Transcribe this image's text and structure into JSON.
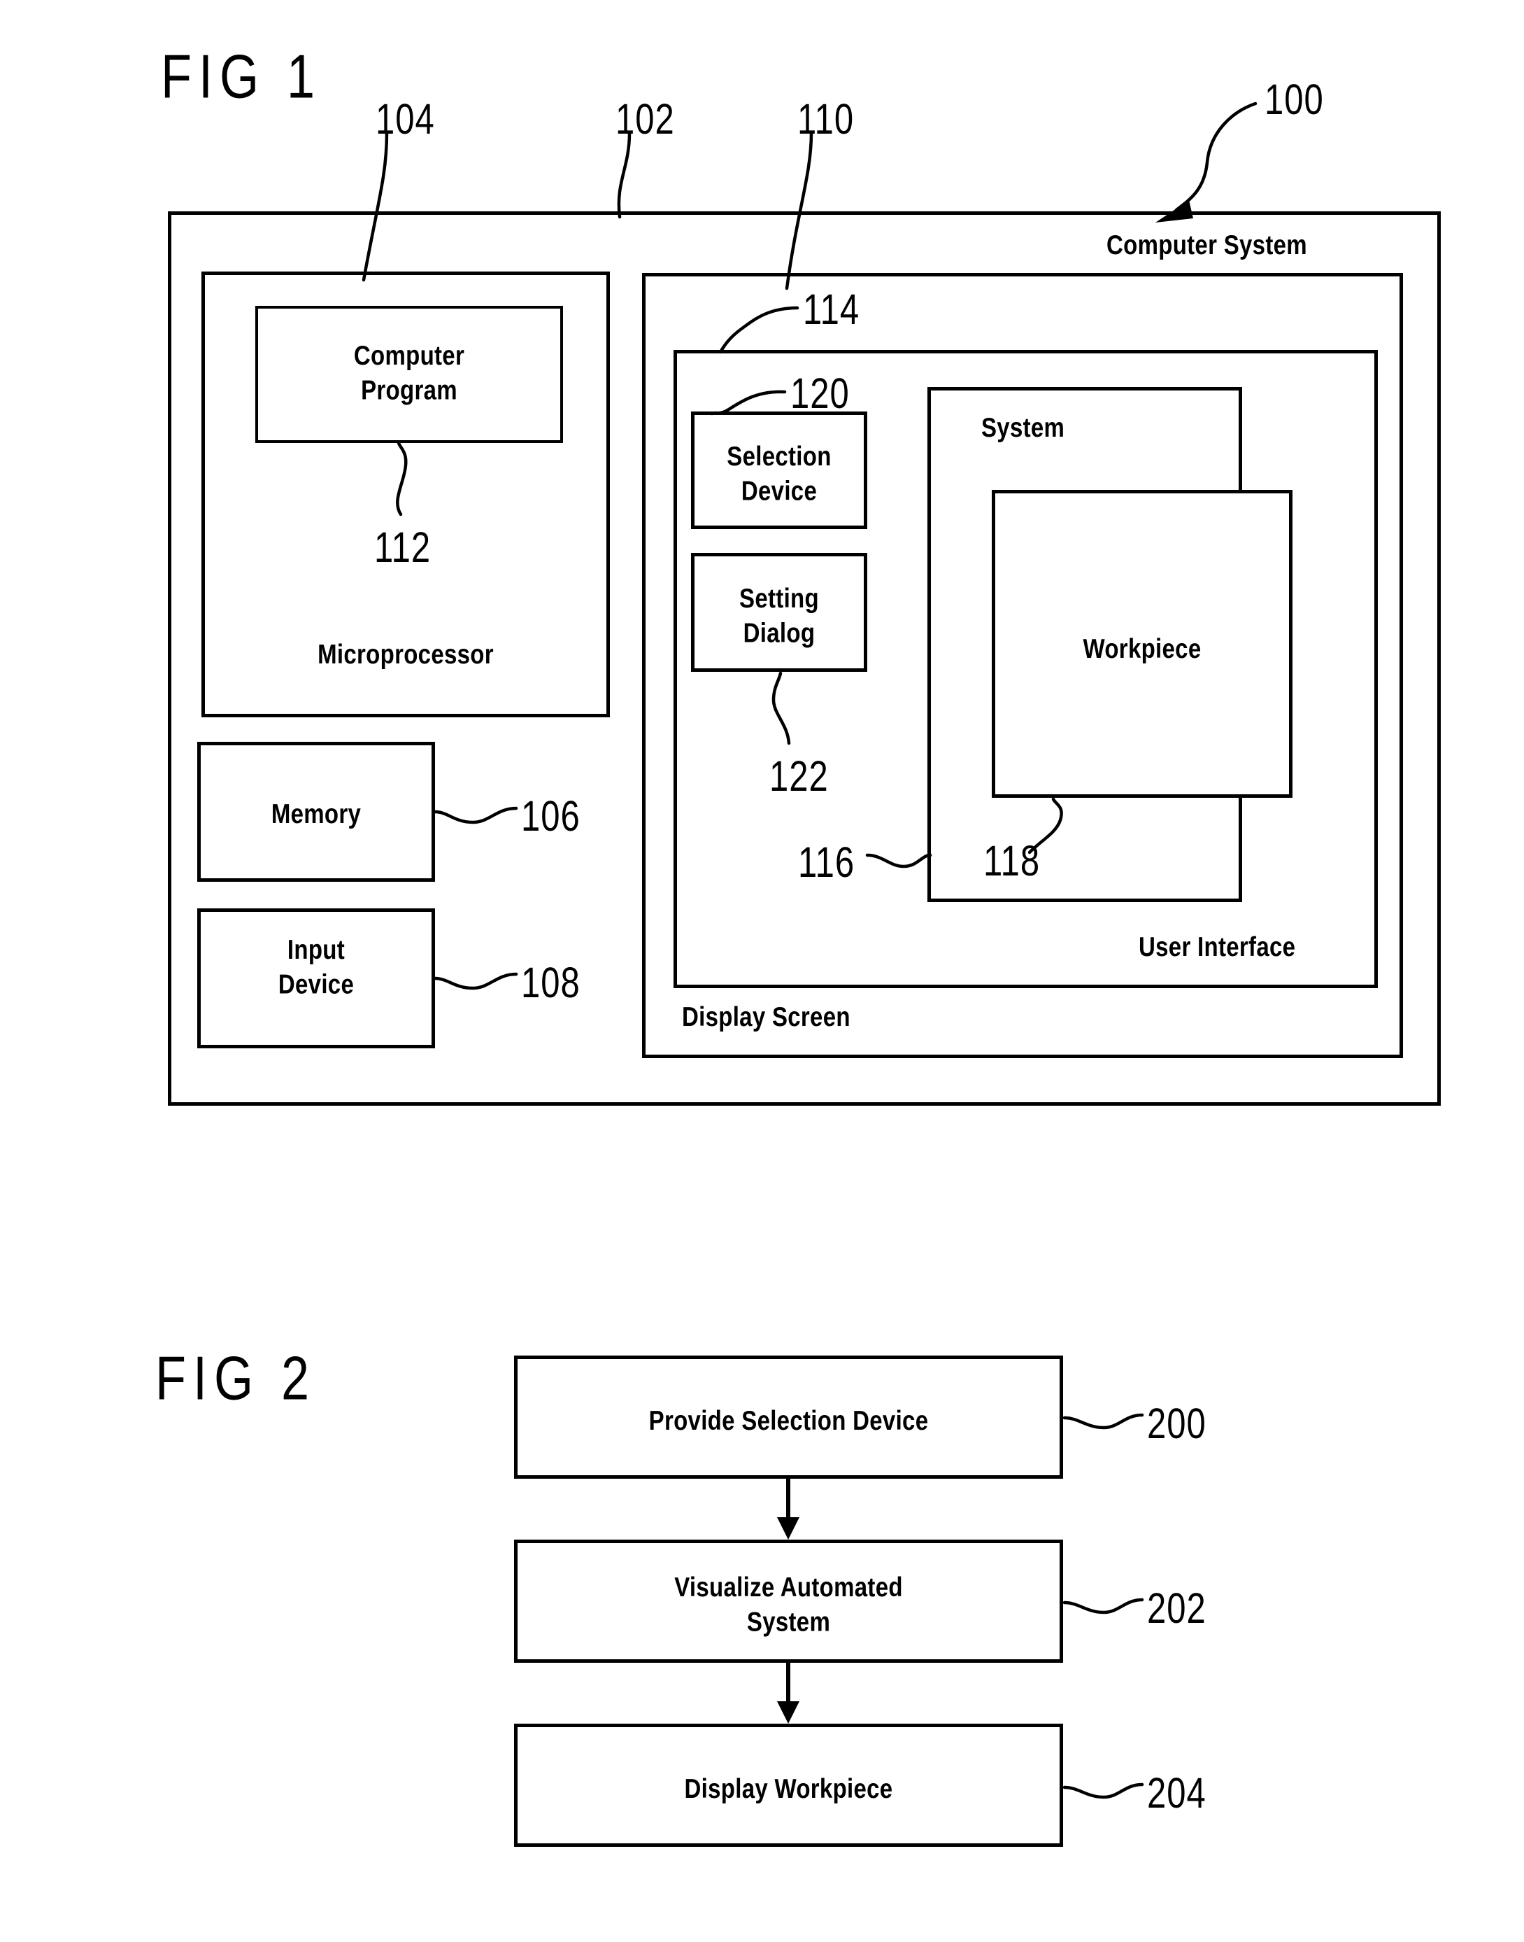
{
  "figures": [
    {
      "title": "FIG 1",
      "system_ref": "100",
      "refs": {
        "microprocessor": "104",
        "computer_system": "102",
        "display_screen": "110",
        "user_interface": "114",
        "selection_device": "120",
        "setting_dialog": "122",
        "memory": "106",
        "input_device": "108",
        "computer_program": "112",
        "system": "116",
        "workpiece": "118"
      },
      "boxes": {
        "computer_system": "Computer System",
        "microprocessor": "Microprocessor",
        "computer_program": "Computer\nProgram",
        "memory": "Memory",
        "input_device": "Input\nDevice",
        "display_screen": "Display Screen",
        "user_interface": "User Interface",
        "selection_device": "Selection\nDevice",
        "setting_dialog": "Setting\nDialog",
        "system": "System",
        "workpiece": "Workpiece"
      }
    },
    {
      "title": "FIG 2",
      "steps": [
        {
          "label": "Provide Selection Device",
          "ref": "200"
        },
        {
          "label": "Visualize Automated\nSystem",
          "ref": "202"
        },
        {
          "label": "Display Workpiece",
          "ref": "204"
        }
      ]
    }
  ],
  "colors": {
    "ink": "#000000",
    "paper": "#ffffff"
  }
}
